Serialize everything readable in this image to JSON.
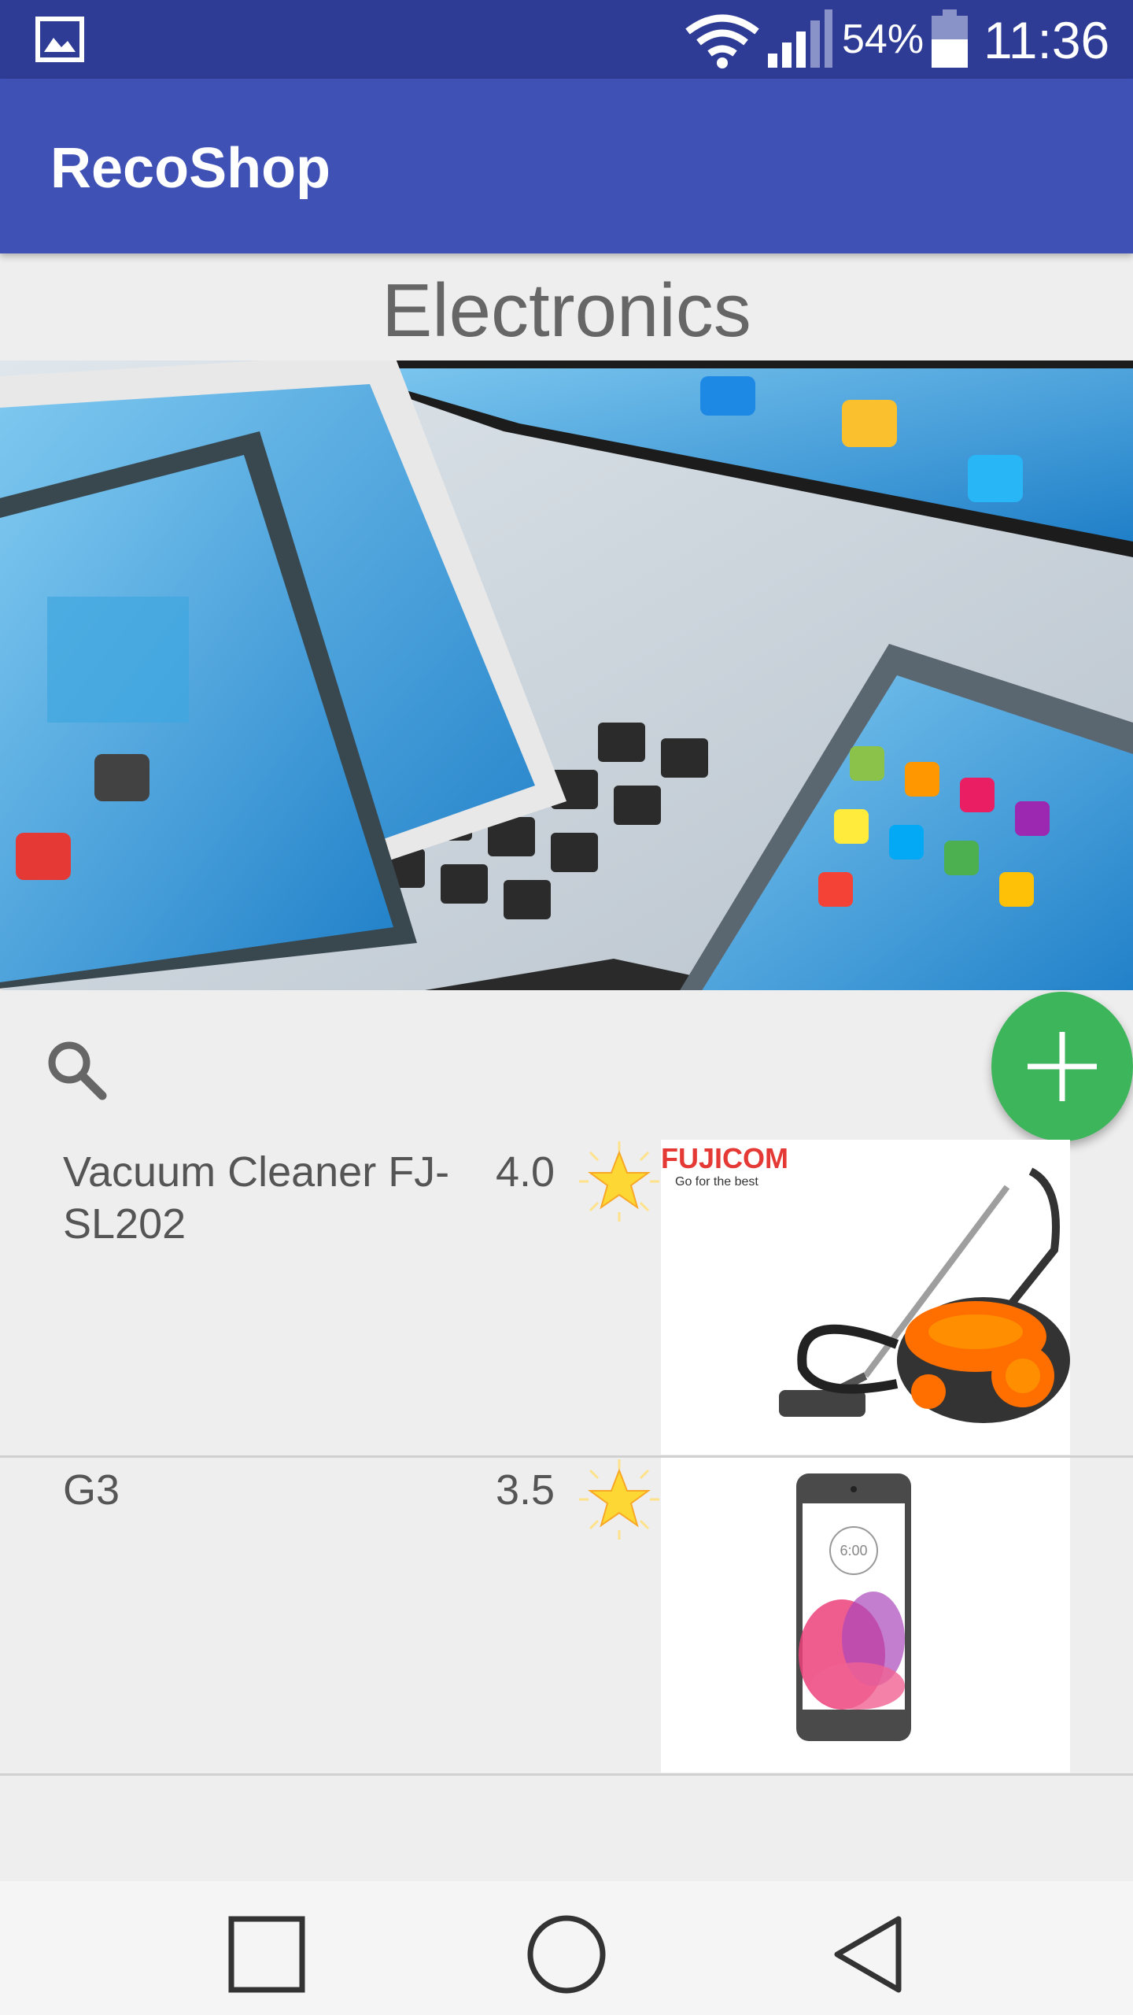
{
  "status_bar": {
    "battery_percent": "54%",
    "time": "11:36",
    "icons": [
      "gallery-icon",
      "wifi-icon",
      "signal-icon",
      "battery-icon"
    ]
  },
  "app_bar": {
    "title": "RecoShop"
  },
  "category": {
    "title": "Electronics",
    "banner_image": "electronics-devices-banner"
  },
  "toolbar": {
    "search_icon": "search-icon",
    "add_icon": "plus-icon"
  },
  "products": [
    {
      "name": "Vacuum Cleaner FJ-SL202",
      "rating": "4.0",
      "rating_icon": "star-icon",
      "image": "vacuum-cleaner-image",
      "brand_logo": "FUJICOM",
      "brand_tagline": "Go for the best"
    },
    {
      "name": "G3",
      "rating": "3.5",
      "rating_icon": "star-icon",
      "image": "smartphone-image",
      "phone_clock": "6:00"
    }
  ],
  "nav_bar": {
    "icons": [
      "recents-icon",
      "home-icon",
      "back-icon"
    ]
  },
  "colors": {
    "status_bar": "#2f3c96",
    "app_bar": "#3f51b5",
    "fab": "#3db55b",
    "background": "#eeeeee",
    "text": "#555555",
    "star": "#fdd835"
  }
}
